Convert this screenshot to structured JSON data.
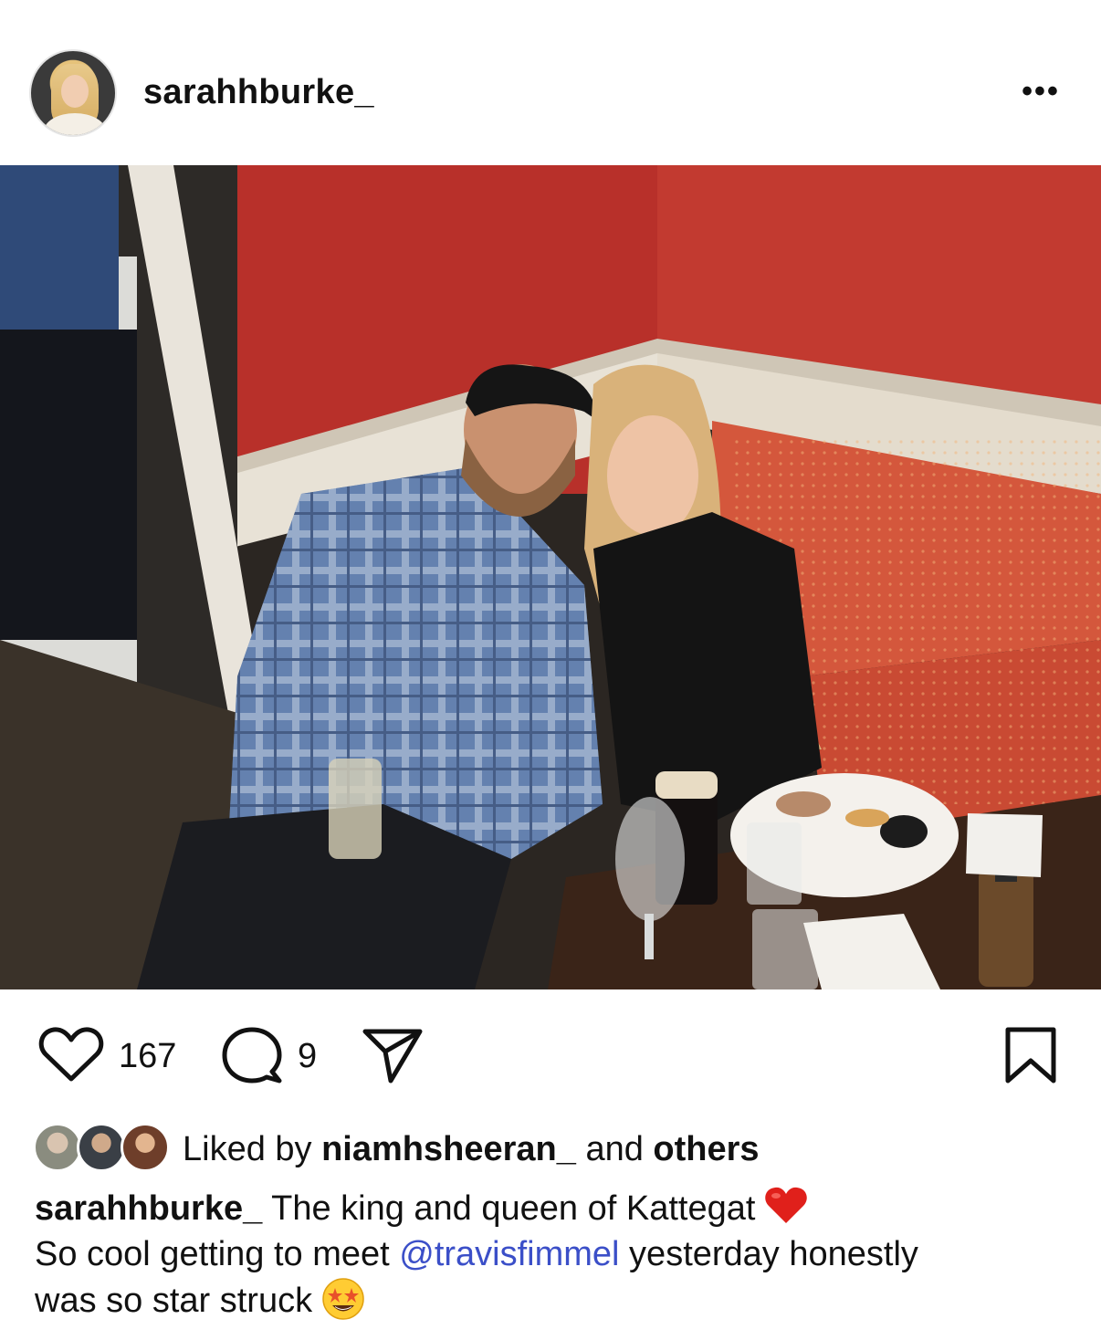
{
  "post": {
    "username": "sarahhburke_",
    "more_label": "•••"
  },
  "actions": {
    "likes": "167",
    "comments": "9"
  },
  "liked_by": {
    "prefix": "Liked by ",
    "user": "niamhsheeran_",
    "middle": " and ",
    "others": "others"
  },
  "caption": {
    "username": "sarahhburke_",
    "line1": " The king and queen of Kattegat",
    "line2_before": "So cool getting to meet ",
    "mention": "@travisfimmel",
    "line2_after": " yesterday honestly",
    "line3": "was so star struck"
  },
  "colors": {
    "mention": "#3b4fc8",
    "heart": "#e0201b"
  }
}
